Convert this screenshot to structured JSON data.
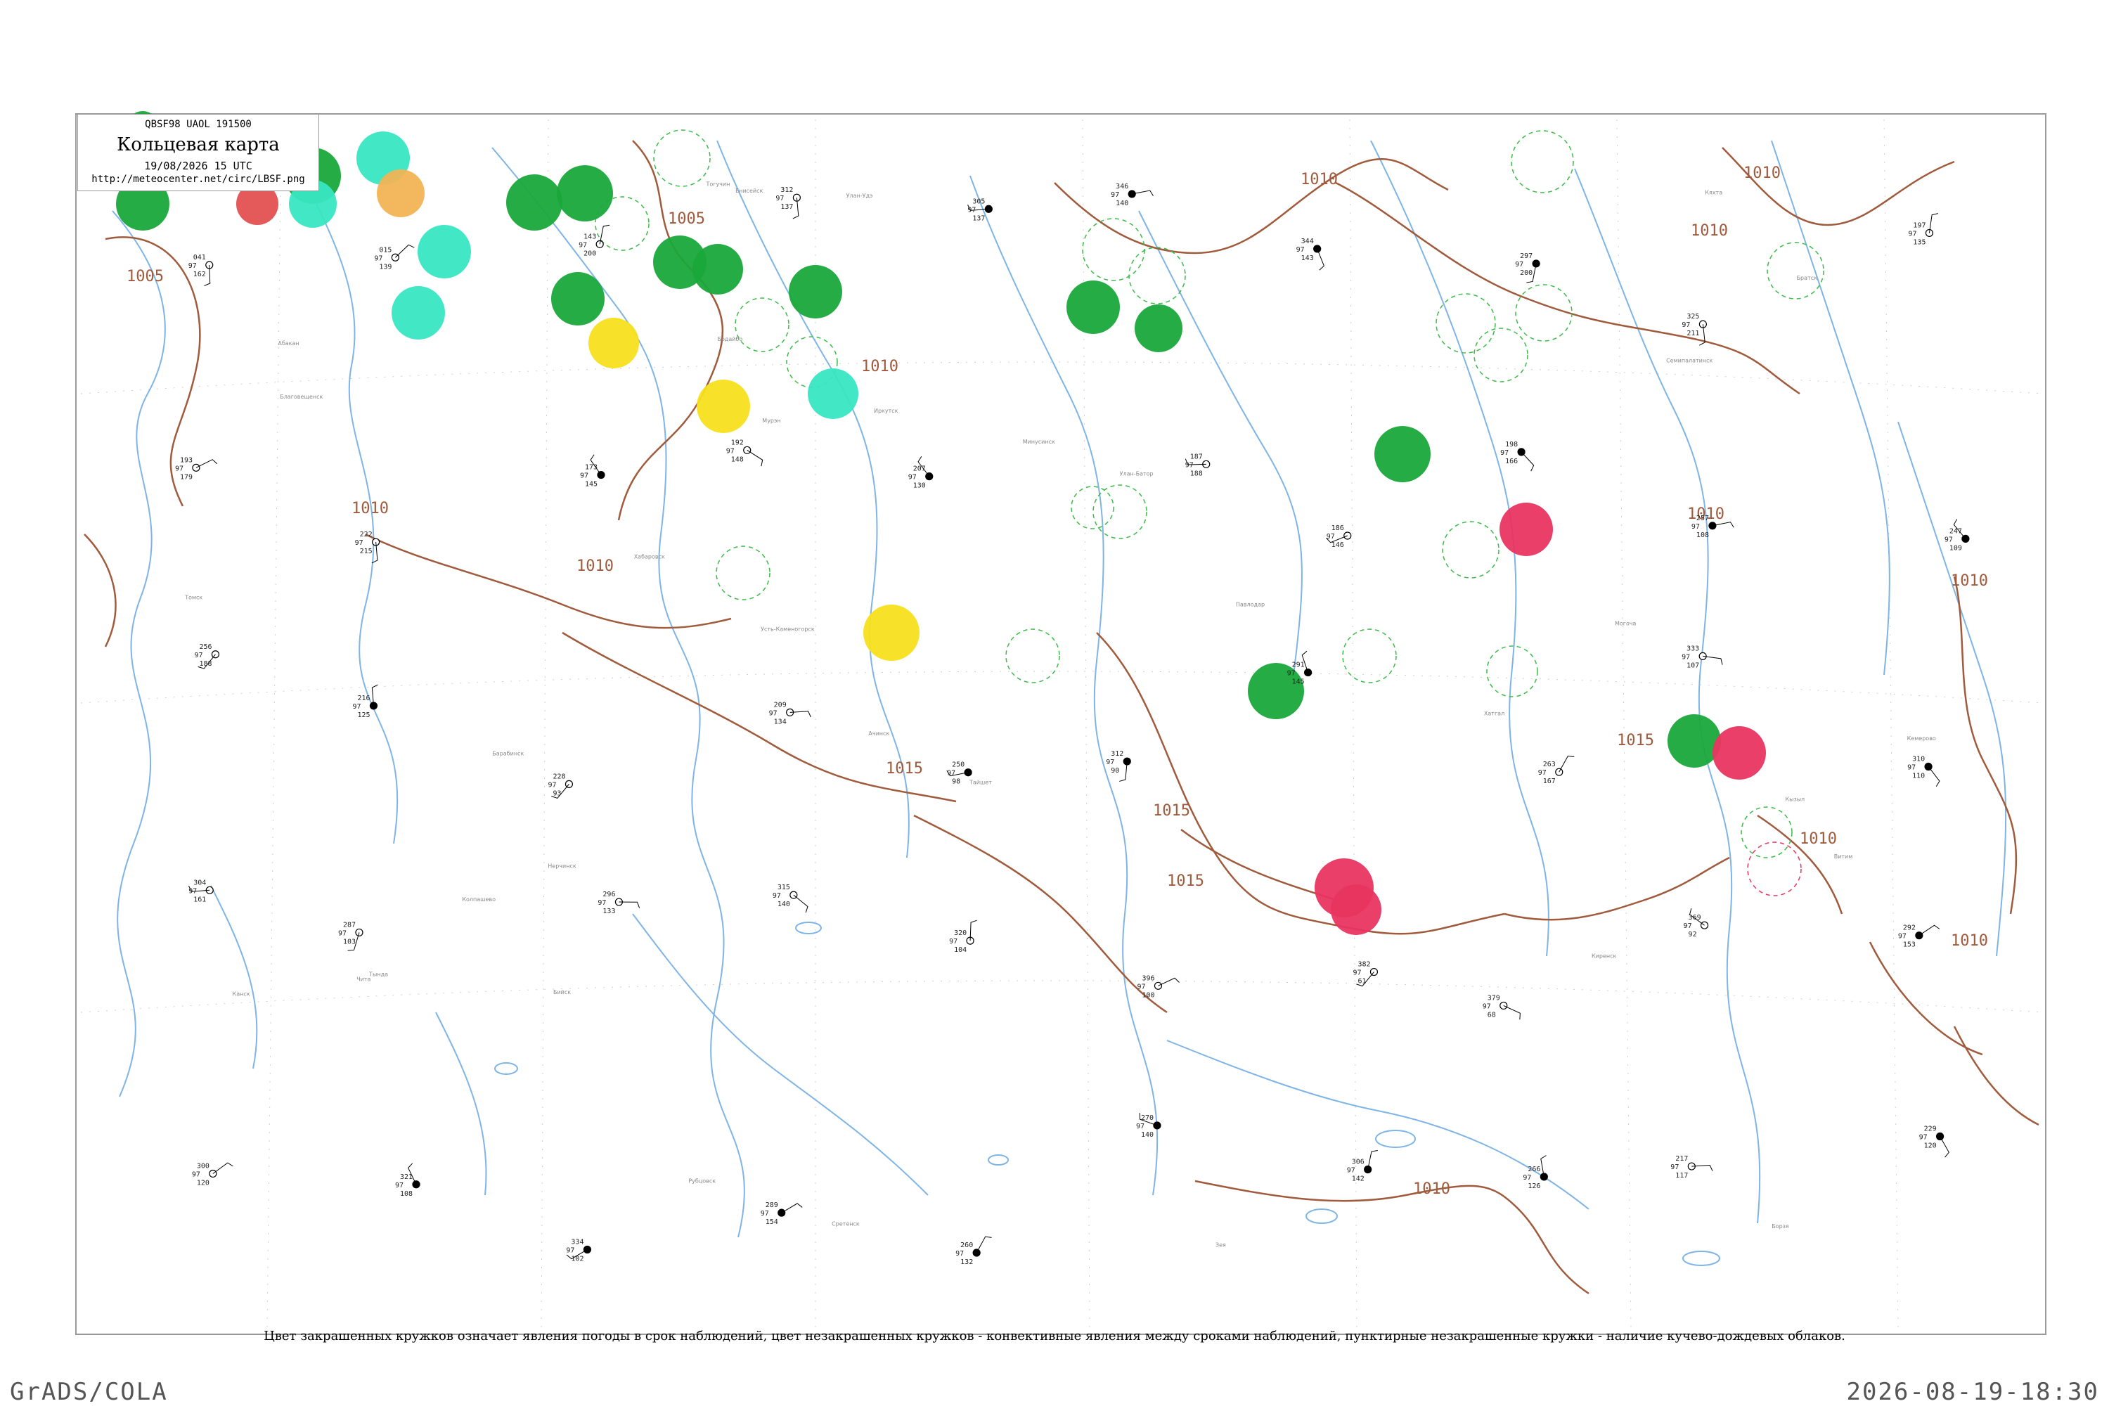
{
  "header": {
    "code_line": "QBSF98  UAOL  191500",
    "title": "Кольцевая карта",
    "date": "19/08/2026 15 UTC",
    "url": "http://meteocenter.net/circ/LBSF.png"
  },
  "footnote": "Цвет закрашенных кружков означает явления погоды в срок наблюдений, цвет незакрашенных кружков - конвективные явления между сроками наблюдений, пунктирные незакрашенные кружки - наличие кучево-дождевых облаков.",
  "footer": {
    "left": "GrADS/COLA",
    "right": "2026-08-19-18:30"
  },
  "colors": {
    "isobar": "#a05a3c",
    "river": "#7fb4e6",
    "rain": "#1aa83a",
    "shower_light": "#38e6c2",
    "haze": "#f2b455",
    "fog_mist": "#f7e01e",
    "thunder": "#e83560",
    "dash_cb": "#3cbb48",
    "frame": "#9a9a9a"
  },
  "isobar_labels": [
    "1005",
    "1005",
    "1010",
    "1010",
    "1010",
    "1010",
    "1010",
    "1010",
    "1010",
    "1010",
    "1015",
    "1015",
    "1015",
    "1015",
    "1010",
    "1010",
    "1010"
  ],
  "sample_stations": [
    {
      "t": "041",
      "p": "97",
      "d": "162"
    },
    {
      "t": "015",
      "p": "97",
      "d": "139"
    },
    {
      "t": "143",
      "p": "97",
      "d": "200"
    },
    {
      "t": "312",
      "p": "97",
      "d": "137"
    },
    {
      "t": "305",
      "p": "97",
      "d": "137"
    },
    {
      "t": "346",
      "p": "97",
      "d": "140"
    },
    {
      "t": "344",
      "p": "97",
      "d": "143"
    },
    {
      "t": "297",
      "p": "97",
      "d": "200"
    },
    {
      "t": "325",
      "p": "97",
      "d": "211"
    },
    {
      "t": "197",
      "p": "97",
      "d": "135"
    },
    {
      "t": "193",
      "p": "97",
      "d": "179"
    },
    {
      "t": "222",
      "p": "97",
      "d": "215"
    },
    {
      "t": "173",
      "p": "97",
      "d": "145"
    },
    {
      "t": "192",
      "p": "97",
      "d": "148"
    },
    {
      "t": "207",
      "p": "97",
      "d": "130"
    },
    {
      "t": "187",
      "p": "97",
      "d": "188"
    },
    {
      "t": "186",
      "p": "97",
      "d": "146"
    },
    {
      "t": "198",
      "p": "97",
      "d": "166"
    },
    {
      "t": "257",
      "p": "97",
      "d": "108"
    },
    {
      "t": "247",
      "p": "97",
      "d": "109"
    },
    {
      "t": "256",
      "p": "97",
      "d": "188"
    },
    {
      "t": "216",
      "p": "97",
      "d": "125"
    },
    {
      "t": "228",
      "p": "97",
      "d": "93"
    },
    {
      "t": "209",
      "p": "97",
      "d": "134"
    },
    {
      "t": "250",
      "p": "97",
      "d": "98"
    },
    {
      "t": "312",
      "p": "97",
      "d": "90"
    },
    {
      "t": "291",
      "p": "97",
      "d": "145"
    },
    {
      "t": "263",
      "p": "97",
      "d": "167"
    },
    {
      "t": "333",
      "p": "97",
      "d": "107"
    },
    {
      "t": "310",
      "p": "97",
      "d": "110"
    },
    {
      "t": "304",
      "p": "97",
      "d": "161"
    },
    {
      "t": "287",
      "p": "97",
      "d": "103"
    },
    {
      "t": "296",
      "p": "97",
      "d": "133"
    },
    {
      "t": "315",
      "p": "97",
      "d": "140"
    },
    {
      "t": "320",
      "p": "97",
      "d": "104"
    },
    {
      "t": "396",
      "p": "97",
      "d": "100"
    },
    {
      "t": "382",
      "p": "97",
      "d": "61"
    },
    {
      "t": "379",
      "p": "97",
      "d": "68"
    },
    {
      "t": "369",
      "p": "97",
      "d": "92"
    },
    {
      "t": "292",
      "p": "97",
      "d": "153"
    },
    {
      "t": "300",
      "p": "97",
      "d": "120"
    },
    {
      "t": "321",
      "p": "97",
      "d": "108"
    },
    {
      "t": "334",
      "p": "97",
      "d": "102"
    },
    {
      "t": "289",
      "p": "97",
      "d": "154"
    },
    {
      "t": "260",
      "p": "97",
      "d": "132"
    },
    {
      "t": "270",
      "p": "97",
      "d": "140"
    },
    {
      "t": "306",
      "p": "97",
      "d": "142"
    },
    {
      "t": "266",
      "p": "97",
      "d": "126"
    },
    {
      "t": "217",
      "p": "97",
      "d": "117"
    },
    {
      "t": "229",
      "p": "97",
      "d": "120"
    }
  ],
  "station_names": [
    "Барабинск",
    "Тогучин",
    "Кемерово",
    "Томск",
    "Колпашево",
    "Бийск",
    "Рубцовск",
    "Павлодар",
    "Семипалатинск",
    "Усть-Каменогорск",
    "Кызыл",
    "Абакан",
    "Минусинск",
    "Ачинск",
    "Енисейск",
    "Канск",
    "Тайшет",
    "Братск",
    "Иркутск",
    "Улан-Удэ",
    "Чита",
    "Кяхта",
    "Улан-Батор",
    "Мурэн",
    "Хатгал",
    "Нерчинск",
    "Борзя",
    "Сретенск",
    "Могоча",
    "Благовещенск",
    "Тында",
    "Зея",
    "Хабаровск",
    "Бодайбо",
    "Витим",
    "Киренск"
  ]
}
